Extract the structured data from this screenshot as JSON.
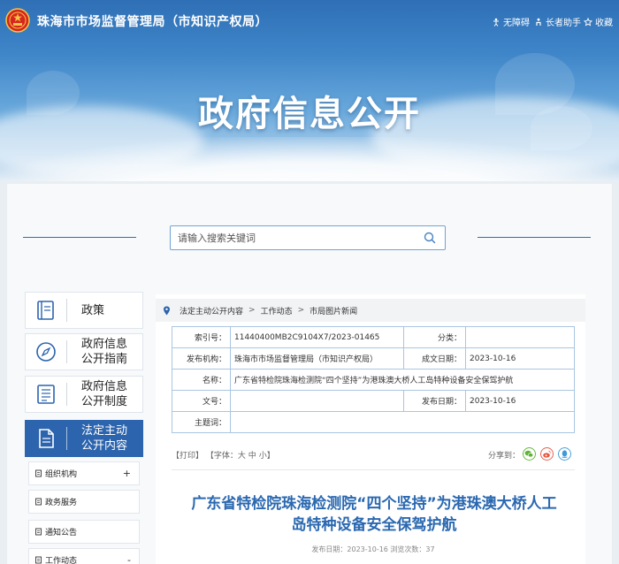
{
  "header": {
    "site_title": "珠海市市场监督管理局（市知识产权局）",
    "links": [
      {
        "label": "无障碍",
        "icon": "accessibility-icon"
      },
      {
        "label": "长者助手",
        "icon": "elder-assist-icon"
      },
      {
        "label": "收藏",
        "icon": "bookmark-icon"
      }
    ],
    "banner_title": "政府信息公开"
  },
  "search": {
    "placeholder": "请输入搜索关键词"
  },
  "nav": {
    "items": [
      {
        "label": "政策",
        "icon": "book-icon"
      },
      {
        "label": "政府信息公开指南",
        "line1": "政府信息",
        "line2": "公开指南",
        "icon": "compass-icon"
      },
      {
        "label": "政府信息公开制度",
        "line1": "政府信息",
        "line2": "公开制度",
        "icon": "list-doc-icon"
      },
      {
        "label": "法定主动公开内容",
        "line1": "法定主动",
        "line2": "公开内容",
        "icon": "document-icon",
        "active": true
      }
    ],
    "sub_items": [
      {
        "label": "组织机构",
        "sign": "+"
      },
      {
        "label": "政务服务",
        "sign": ""
      },
      {
        "label": "通知公告",
        "sign": ""
      },
      {
        "label": "工作动态",
        "sign": "-"
      }
    ]
  },
  "breadcrumb": [
    "法定主动公开内容",
    "工作动态",
    "市局图片新闻"
  ],
  "meta": {
    "index_label": "索引号：",
    "index_value": "11440400MB2C9104X7/2023-01465",
    "category_label": "分类：",
    "category_value": "",
    "issuer_label": "发布机构：",
    "issuer_value": "珠海市市场监督管理局（市知识产权局）",
    "created_label": "成文日期：",
    "created_value": "2023-10-16",
    "name_label": "名称：",
    "name_value": "广东省特检院珠海检测院“四个坚持”为港珠澳大桥人工岛特种设备安全保驾护航",
    "docno_label": "文号：",
    "docno_value": "",
    "published_label": "发布日期：",
    "published_value": "2023-10-16",
    "keywords_label": "主题词：",
    "keywords_value": ""
  },
  "tools": {
    "print": "【打印】",
    "font_label": "【字体：",
    "large": "大",
    "medium": "中",
    "small": "小",
    "font_end": "】"
  },
  "share": {
    "label": "分享到：",
    "icons": [
      "wechat-icon",
      "weibo-icon",
      "qq-icon"
    ],
    "colors": [
      "#5fb336",
      "#e7553f",
      "#3d9ad8"
    ]
  },
  "article": {
    "title_line1": "广东省特检院珠海检测院“四个坚持”为港珠澳大桥人工",
    "title_line2": "岛特种设备安全保驾护航",
    "meta": "发布日期：2023-10-16  浏览次数：37"
  }
}
